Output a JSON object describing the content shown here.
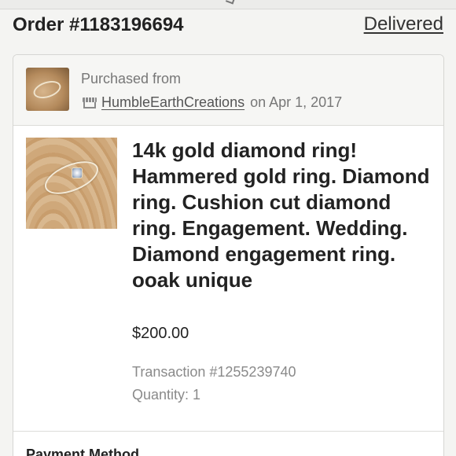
{
  "header": {
    "order_number": "Order #1183196694",
    "status": "Delivered"
  },
  "shop": {
    "purchased_label": "Purchased from",
    "shop_icon": "shop-icon",
    "shop_name": "HumbleEarthCreations",
    "date_text": "on Apr 1, 2017"
  },
  "item": {
    "title": "14k gold diamond ring! Hammered gold ring. Diamond ring. Cushion cut diamond ring. Engagement. Wedding. Diamond engagement ring. ooak unique",
    "price": "$200.00",
    "transaction": "Transaction #1255239740",
    "quantity": "Quantity: 1"
  },
  "payment": {
    "heading": "Payment Method"
  }
}
